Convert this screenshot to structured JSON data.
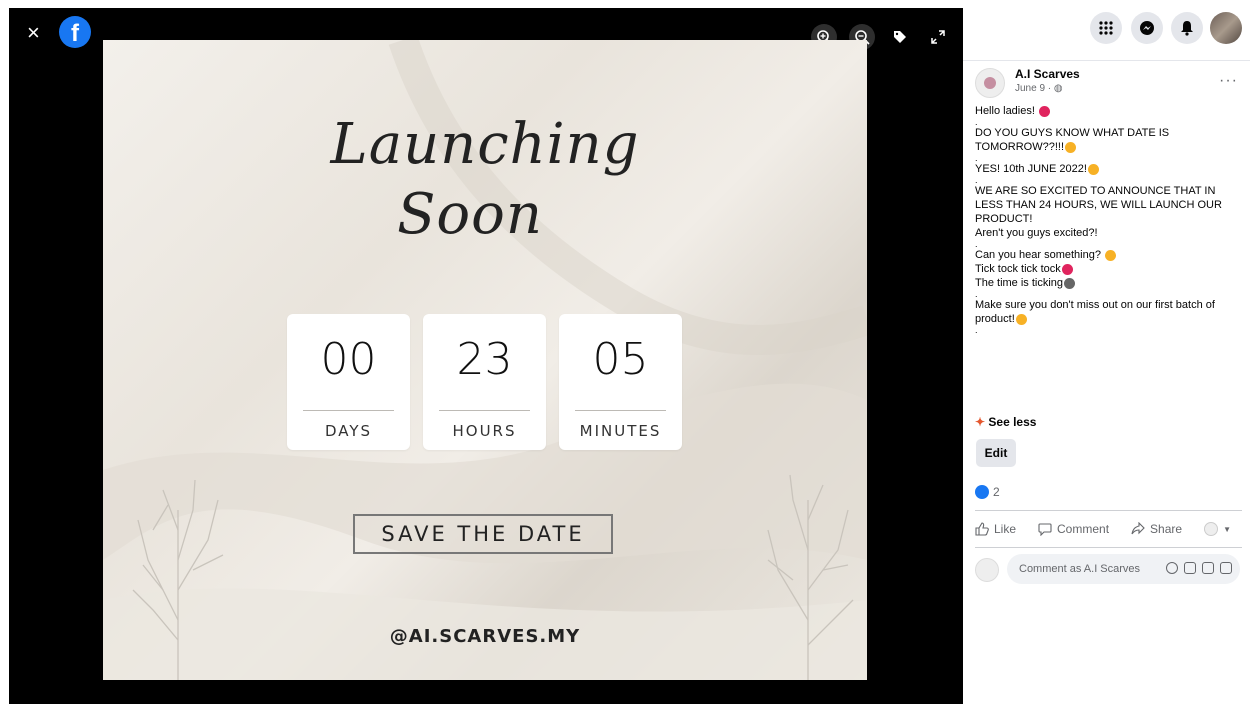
{
  "viewer": {
    "close_glyph": "×",
    "logo_letter": "f",
    "photo": {
      "script_line1": "Launching",
      "script_line2": "Soon",
      "counters": [
        {
          "value": "00",
          "label": "DAYS"
        },
        {
          "value": "23",
          "label": "HOURS"
        },
        {
          "value": "05",
          "label": "MINUTES"
        }
      ],
      "save_the_date": "SAVE THE DATE",
      "handle": "@AI.SCARVES.MY"
    },
    "tools": [
      "zoom-in-icon",
      "zoom-out-icon",
      "tag-icon",
      "fullscreen-icon"
    ]
  },
  "post": {
    "author": "A.I Scarves",
    "meta": "June 9 · ",
    "paragraphs": [
      "Hello ladies!",
      ".",
      "DO YOU GUYS KNOW WHAT DATE IS TOMORROW??!!!",
      ".",
      "YES! 10th JUNE 2022!",
      ".",
      "WE ARE SO EXCITED TO ANNOUNCE THAT IN LESS THAN 24 HOURS, WE WILL LAUNCH OUR PRODUCT!",
      "Aren't you guys excited?!",
      ".",
      "Can you hear something?",
      "Tick tock tick tock",
      "The time is ticking",
      ".",
      "Make sure you don't miss out on our first batch of product!",
      "."
    ],
    "see_less": "See less",
    "edit": "Edit",
    "reaction_count": "2",
    "actions": {
      "like": "Like",
      "comment": "Comment",
      "share": "Share"
    },
    "comment_placeholder": "Comment as A.I Scarves"
  },
  "colors": {
    "brand": "#1877f2",
    "emoji": "#f7b125"
  }
}
